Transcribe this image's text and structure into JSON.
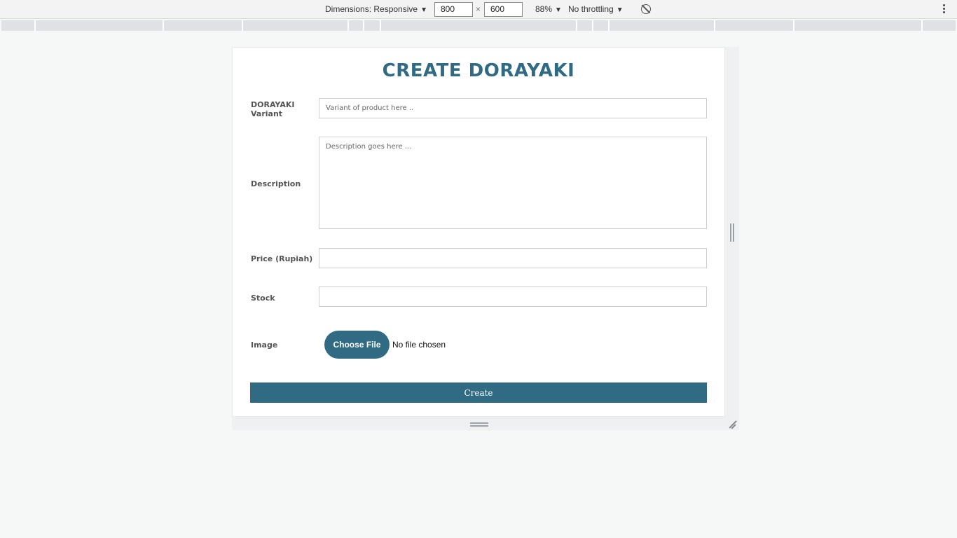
{
  "devtools": {
    "dimensions_label": "Dimensions: Responsive",
    "width_value": "800",
    "times_sign": "×",
    "height_value": "600",
    "zoom_label": "88%",
    "throttling_label": "No throttling",
    "caret": "▼"
  },
  "form": {
    "title": "CREATE DORAYAKI",
    "variant_label_line1": "DORAYAKI",
    "variant_label_line2": "Variant",
    "variant_placeholder": "Variant of product here ..",
    "description_label": "Description",
    "description_placeholder": "Description goes here ...",
    "price_label": "Price (Rupiah)",
    "stock_label": "Stock",
    "image_label": "Image",
    "choose_file_label": "Choose File",
    "no_file_text": "No file chosen",
    "create_label": "Create"
  },
  "colors": {
    "accent": "#306b83",
    "page_background": "#f6f7f7",
    "ruler": "#dfe1e5"
  }
}
